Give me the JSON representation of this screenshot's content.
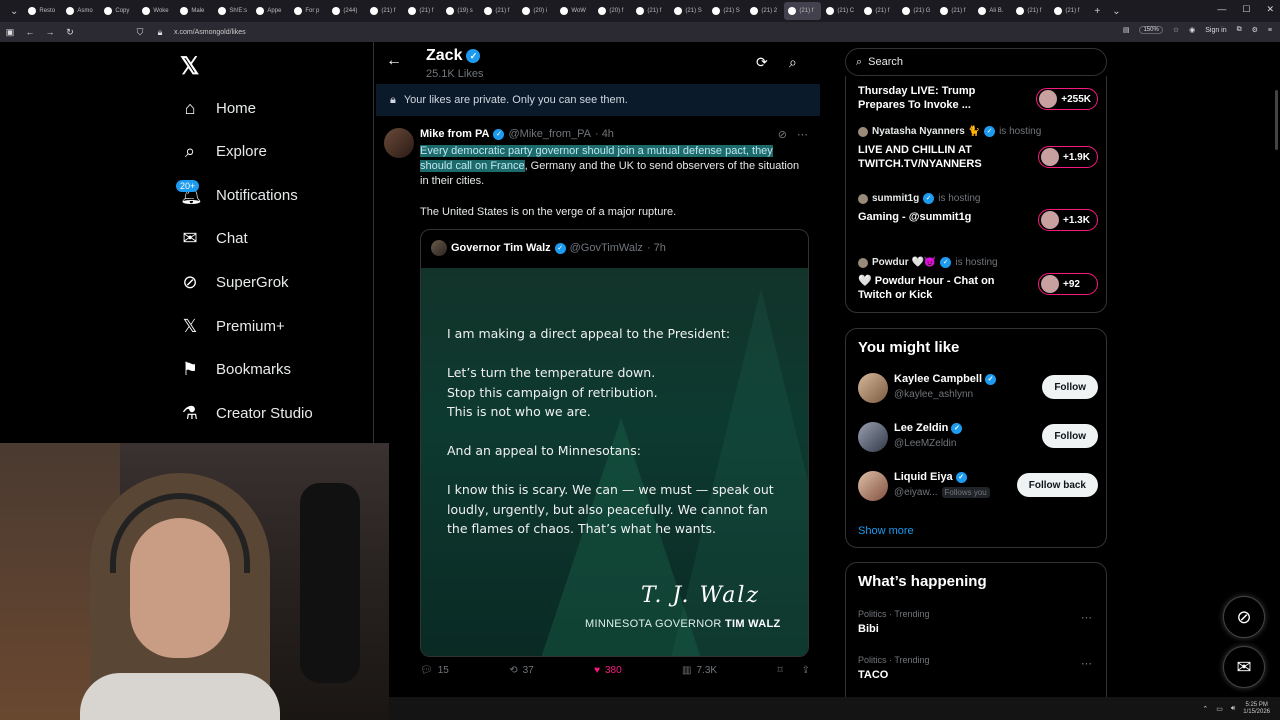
{
  "browser": {
    "tabs": [
      {
        "label": "Resto"
      },
      {
        "label": "Asmo"
      },
      {
        "label": "Copy"
      },
      {
        "label": "Woke"
      },
      {
        "label": "Male"
      },
      {
        "label": "Sh!E:s"
      },
      {
        "label": "Appe"
      },
      {
        "label": "For p"
      },
      {
        "label": "(244)"
      },
      {
        "label": "(21) f"
      },
      {
        "label": "(21) f"
      },
      {
        "label": "(19) s"
      },
      {
        "label": "(21) f"
      },
      {
        "label": "(20) i"
      },
      {
        "label": "WoW"
      },
      {
        "label": "(20) f"
      },
      {
        "label": "(21) f"
      },
      {
        "label": "(21) S"
      },
      {
        "label": "(21) S"
      },
      {
        "label": "(21) 2"
      },
      {
        "label": "(21) f"
      },
      {
        "label": "(21) C"
      },
      {
        "label": "(21) f"
      },
      {
        "label": "(21) G"
      },
      {
        "label": "(21) f"
      },
      {
        "label": "Ali B."
      },
      {
        "label": "(21) f"
      },
      {
        "label": "(21) f"
      }
    ],
    "url": "x.com/Asmongold/likes",
    "zoom": "150%",
    "sign_in": "Sign in"
  },
  "leftnav": {
    "items": [
      {
        "label": "Home",
        "icon": "home-icon"
      },
      {
        "label": "Explore",
        "icon": "search-icon"
      },
      {
        "label": "Notifications",
        "icon": "bell-icon"
      },
      {
        "label": "Chat",
        "icon": "mail-icon"
      },
      {
        "label": "SuperGrok",
        "icon": "grok-icon"
      },
      {
        "label": "Premium+",
        "icon": "x-icon"
      },
      {
        "label": "Bookmarks",
        "icon": "bookmark-icon"
      },
      {
        "label": "Creator Studio",
        "icon": "flask-icon"
      }
    ],
    "notif_badge": "20+"
  },
  "profile": {
    "name": "Zack",
    "likes": "25.1K Likes",
    "private_notice": "Your likes are private. Only you can see them."
  },
  "tweet": {
    "author": "Mike from PA",
    "handle": "@Mike_from_PA",
    "time": "· 4h",
    "text_highlight": "Every democratic party governor should join a mutual defense pact, they should call on France",
    "text_rest": ", Germany and the UK to send observers of the situation in their cities.",
    "text2": "The United States is on the verge of a major rupture.",
    "quote": {
      "author": "Governor Tim Walz",
      "handle": "@GovTimWalz",
      "time": "· 7h",
      "lines": [
        "I am making a direct appeal to the President:",
        "Let’s turn the temperature down.",
        "Stop this campaign of retribution.",
        "This is not who we are.",
        "And an appeal to Minnesotans:",
        "I know this is scary. We can — we must — speak out",
        "loudly, urgently, but also peacefully. We cannot fan",
        "the flames of chaos. That’s what he wants."
      ],
      "signature": "T. J. Walz",
      "caption_prefix": "MINNESOTA GOVERNOR",
      "caption_name": "TIM WALZ"
    },
    "replies": "15",
    "reposts": "37",
    "likes": "380",
    "views": "7.3K"
  },
  "right": {
    "search_placeholder": "Search",
    "live": [
      {
        "host": "",
        "hosting": "",
        "title": "Thursday LIVE: Trump Prepares To Invoke ...",
        "count": "+255K"
      },
      {
        "host": "Nyatasha Nyanners 🐈",
        "hosting": "is hosting",
        "title": "LIVE AND CHILLIN AT TWITCH.TV/NYANNERS",
        "count": "+1.9K"
      },
      {
        "host": "summit1g",
        "hosting": "is hosting",
        "title": "Gaming - @summit1g",
        "count": "+1.3K"
      },
      {
        "host": "Powdur 🤍😈",
        "hosting": "is hosting",
        "title": "🤍 Powdur Hour - Chat on Twitch or Kick",
        "count": "+92"
      }
    ],
    "wtf_title": "You might like",
    "wtf": [
      {
        "name": "Kaylee Campbell",
        "handle": "@kaylee_ashlynn",
        "button": "Follow",
        "follows_you": ""
      },
      {
        "name": "Lee Zeldin",
        "handle": "@LeeMZeldin",
        "button": "Follow",
        "follows_you": ""
      },
      {
        "name": "Liquid Eiya",
        "handle": "@eiyaw...",
        "button": "Follow back",
        "follows_you": "Follows you"
      }
    ],
    "show_more": "Show more",
    "trends_title": "What’s happening",
    "trends": [
      {
        "meta": "Politics · Trending",
        "name": "Bibi"
      },
      {
        "meta": "Politics · Trending",
        "name": "TACO"
      }
    ]
  },
  "taskbar": {
    "time": "5:25 PM",
    "date": "1/15/2026"
  },
  "colors": {
    "accent": "#1d9bf0",
    "like": "#f91880",
    "highlight": "#1c6a6a"
  }
}
